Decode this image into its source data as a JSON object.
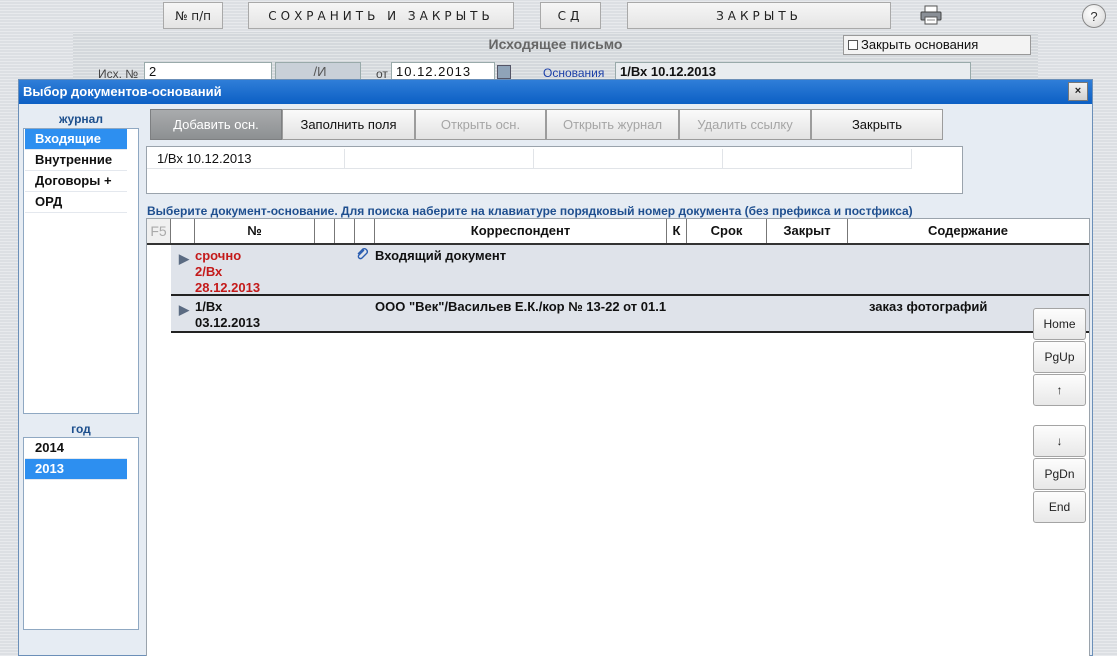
{
  "toolbar": {
    "num_label": "№ п/п",
    "save_close_label": "СОХРАНИТЬ И ЗАКРЫТЬ",
    "sd_label": "СД",
    "close_label": "ЗАКРЫТЬ",
    "help_label": "?"
  },
  "background_form": {
    "title": "Исходящее письмо",
    "close_bases_label": "Закрыть основания",
    "out_no_label": "Исх. №",
    "out_no_value": "2",
    "suffix_value": "/И",
    "date_label": "от",
    "date_value": "10.12.2013",
    "bases_label": "Основания",
    "bases_value": "1/Вх  10.12.2013"
  },
  "dialog": {
    "title": "Выбор документов-оснований",
    "close_label": "×",
    "journal_label": "журнал",
    "journals": [
      "Входящие",
      "Внутренние",
      "Договоры +",
      "ОРД"
    ],
    "selected_journal": "Входящие",
    "year_label": "год",
    "years": [
      "2014",
      "2013"
    ],
    "selected_year": "2013",
    "buttons": {
      "add": "Добавить осн.",
      "fill": "Заполнить поля",
      "open_base": "Открыть осн.",
      "open_journal": "Открыть журнал",
      "delete_link": "Удалить ссылку",
      "close": "Закрыть"
    },
    "selected_link": "1/Вх  10.12.2013",
    "hint": "Выберите документ-основание. Для поиска наберите на клавиатуре порядковый номер документа (без префикса и постфикса)",
    "columns": {
      "f5": "F5",
      "number": "№",
      "correspondent": "Корреспондент",
      "k": "К",
      "due": "Срок",
      "closed": "Закрыт",
      "content": "Содержание"
    },
    "rows": [
      {
        "urgency": "срочно",
        "number": "2/Вх",
        "date": "28.12.2013",
        "has_attachment": true,
        "correspondent": "Входящий документ",
        "content": ""
      },
      {
        "urgency": "",
        "number": "1/Вх",
        "date": "03.12.2013",
        "has_attachment": false,
        "correspondent": "ООО \"Век\"/Васильев Е.К./кор № 13-22 от 01.1",
        "content": "заказ фотографий"
      }
    ],
    "nav": {
      "home": "Home",
      "pgup": "PgUp",
      "up": "↑",
      "down": "↓",
      "pgdn": "PgDn",
      "end": "End"
    }
  },
  "colors": {
    "titlebar": "#0c5fc4",
    "selected": "#2d8ff0",
    "urgent": "#c41a1a",
    "label_blue": "#1d4f8d"
  }
}
